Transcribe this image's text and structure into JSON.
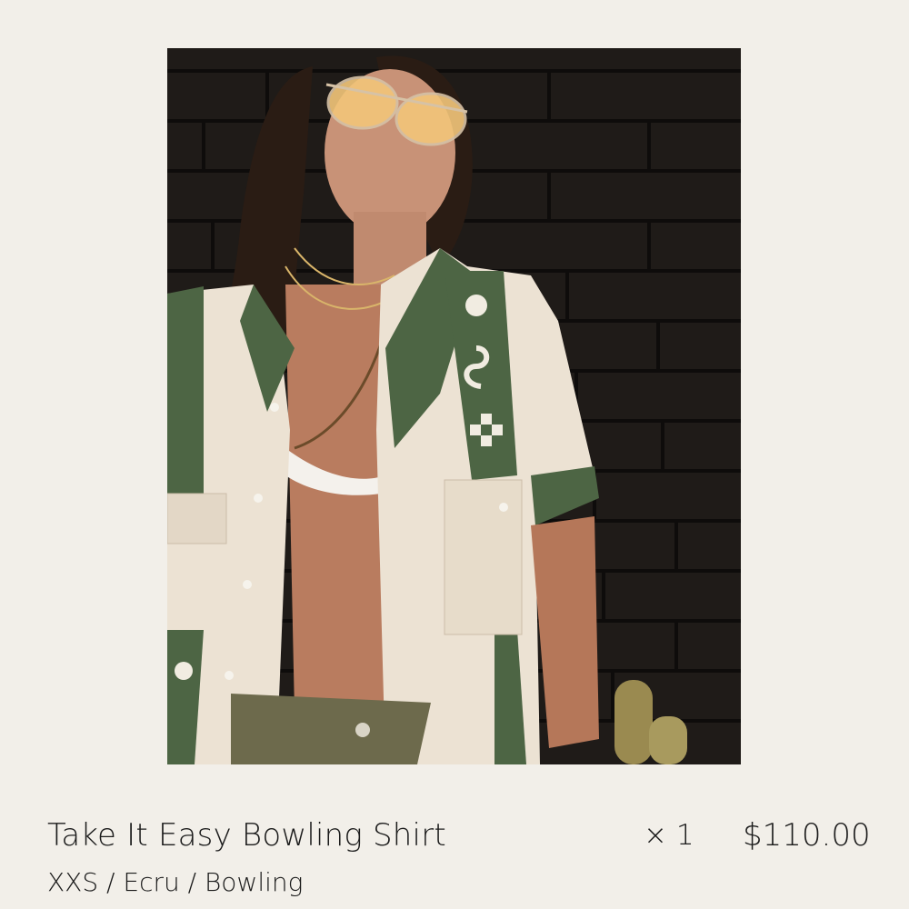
{
  "cart_item": {
    "image_alt_icon": "product-photo",
    "title": "Take It Easy Bowling Shirt",
    "variant": "XXS / Ecru / Bowling",
    "quantity": "× 1",
    "price": "$110.00"
  },
  "colors": {
    "background": "#f2efe9",
    "shirt_cream": "#ece2d3",
    "shirt_green": "#4d6544",
    "brick_wall": "#1e1a17"
  }
}
